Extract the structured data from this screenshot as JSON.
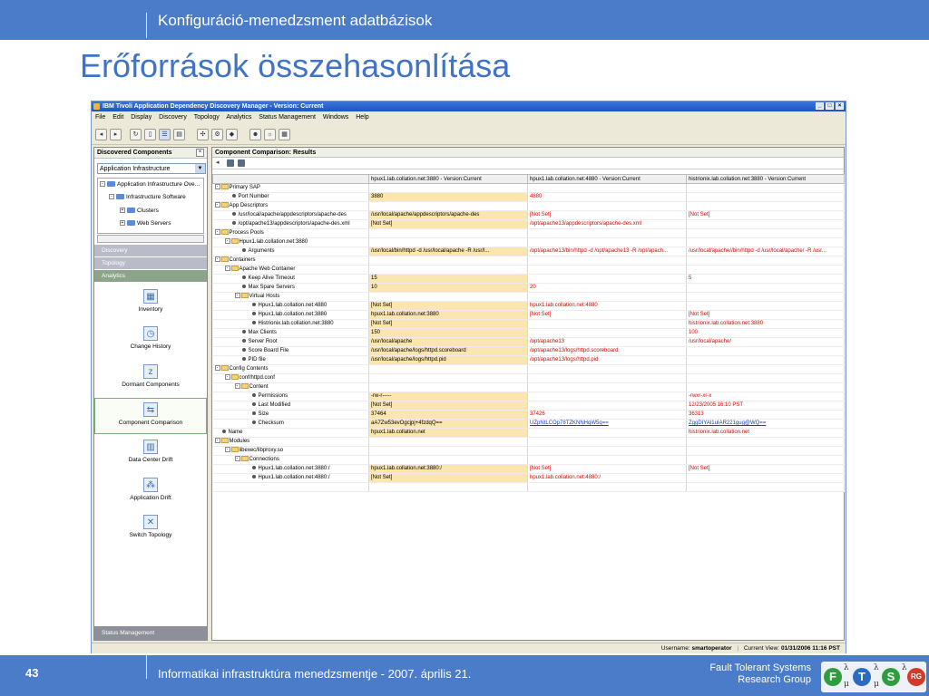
{
  "slide": {
    "header": "Konfiguráció-menedzsment adatbázisok",
    "title": "Erőforrások összehasonlítása",
    "page_number": "43",
    "footer": "Informatikai infrastruktúra menedzsmentje - 2007. április 21.",
    "org_line1": "Fault Tolerant Systems",
    "org_line2": "Research Group",
    "logo": {
      "f": "F",
      "t": "T",
      "s": "S",
      "rg": "RG",
      "lambda": "λ",
      "mu": "μ"
    }
  },
  "colors": {
    "bar": "#4a7cc9",
    "title": "#3f73c6",
    "highlight": "#fce6b0",
    "red": "#e00000"
  },
  "app": {
    "title": "IBM Tivoli Application Dependency Discovery Manager - Version: Current",
    "menu": [
      "File",
      "Edit",
      "Display",
      "Discovery",
      "Topology",
      "Analytics",
      "Status Management",
      "Windows",
      "Help"
    ],
    "left": {
      "header": "Discovered Components",
      "select": "Application Infrastructure",
      "tree": [
        "Application Infrastructure Ove...",
        "Infrastructure Software",
        "Clusters",
        "Web Servers"
      ],
      "nav": [
        "Discovery",
        "Topology",
        "Analytics"
      ],
      "items": [
        "Inventory",
        "Change History",
        "Dormant Components",
        "Component Comparison",
        "Data Center Drift",
        "Application Drift",
        "Switch Topology"
      ],
      "status_mgmt": "Status Management"
    },
    "right": {
      "header": "Component Comparison: Results",
      "columns": [
        "hpux1.lab.collation.net:3880 - Version:Current",
        "hpux1.lab.collation.net:4880 - Version:Current",
        "histrionix.lab.collation.net:3880 - Version:Current"
      ],
      "rows": [
        {
          "l": "Primary SAP",
          "d": 0,
          "k": "f",
          "v": [
            "",
            "",
            ""
          ]
        },
        {
          "l": "Port Number",
          "d": 1,
          "k": "b",
          "v": [
            "3880",
            "4880",
            ""
          ],
          "c": [
            "v1",
            "red",
            ""
          ]
        },
        {
          "l": "App Descriptors",
          "d": 0,
          "k": "f",
          "v": [
            "",
            "",
            ""
          ]
        },
        {
          "l": "/usr/local/apache/appdescriptors/apache-des",
          "d": 1,
          "k": "b",
          "v": [
            "/usr/local/apache/appdescriptors/apache-des",
            "[Not Set]",
            "[Not Set]"
          ],
          "c": [
            "v1",
            "red",
            "red"
          ]
        },
        {
          "l": "/opt/apache13/appdescriptors/apache-des.xml",
          "d": 1,
          "k": "b",
          "v": [
            "[Not Set]",
            "/opt/apache13/appdescriptors/apache-des.xml",
            ""
          ],
          "c": [
            "v1",
            "red",
            ""
          ]
        },
        {
          "l": "Process Pools",
          "d": 0,
          "k": "f",
          "v": [
            "",
            "",
            ""
          ]
        },
        {
          "l": "Hpux1.lab.collation.net:3880",
          "d": 1,
          "k": "f",
          "v": [
            "",
            "",
            ""
          ]
        },
        {
          "l": "Arguments",
          "d": 2,
          "k": "b",
          "v": [
            "/usr/local/bin/httpd -d /usr/local/apache -R /usr/l...",
            "/opt/apache13/bin/httpd -d /opt/apache13 -R /opt/apach...",
            "/usr/local/apache//bin/httpd -d /usr/local/apache/ -R /usr..."
          ],
          "c": [
            "v1",
            "red",
            "red"
          ]
        },
        {
          "l": "Containers",
          "d": 0,
          "k": "f",
          "v": [
            "",
            "",
            ""
          ]
        },
        {
          "l": "Apache Web Container",
          "d": 1,
          "k": "f",
          "v": [
            "",
            "",
            ""
          ]
        },
        {
          "l": "Keep Alive Timeout",
          "d": 2,
          "k": "b",
          "v": [
            "15",
            "",
            "5"
          ],
          "c": [
            "v1",
            "",
            "red"
          ]
        },
        {
          "l": "Max Spare Servers",
          "d": 2,
          "k": "b",
          "v": [
            "10",
            "20",
            ""
          ],
          "c": [
            "v1",
            "red",
            ""
          ]
        },
        {
          "l": "Virtual Hosts",
          "d": 2,
          "k": "f",
          "v": [
            "",
            "",
            ""
          ]
        },
        {
          "l": "Hpux1.lab.collation.net:4880",
          "d": 3,
          "k": "b",
          "v": [
            "[Not Set]",
            "hpux1.lab.collation.net:4880",
            ""
          ],
          "c": [
            "v1",
            "red",
            ""
          ]
        },
        {
          "l": "Hpux1.lab.collation.net:3880",
          "d": 3,
          "k": "b",
          "v": [
            "hpux1.lab.collation.net:3880",
            "[Not Set]",
            "[Not Set]"
          ],
          "c": [
            "v1",
            "red",
            "red"
          ]
        },
        {
          "l": "Histrionix.lab.collation.net:3880",
          "d": 3,
          "k": "b",
          "v": [
            "[Not Set]",
            "",
            "histrionix.lab.collation.net:3880"
          ],
          "c": [
            "v1",
            "",
            "red"
          ]
        },
        {
          "l": "Max Clients",
          "d": 2,
          "k": "b",
          "v": [
            "150",
            "",
            "100"
          ],
          "c": [
            "v1",
            "",
            "red"
          ]
        },
        {
          "l": "Server Root",
          "d": 2,
          "k": "b",
          "v": [
            "/usr/local/apache",
            "/opt/apache13",
            "/usr/local/apache/"
          ],
          "c": [
            "v1",
            "red",
            "red"
          ]
        },
        {
          "l": "Score Board File",
          "d": 2,
          "k": "b",
          "v": [
            "/usr/local/apache/logs/httpd.scoreboard",
            "/opt/apache13/logs/httpd.scoreboard",
            ""
          ],
          "c": [
            "v1",
            "red",
            ""
          ]
        },
        {
          "l": "PID file",
          "d": 2,
          "k": "b",
          "v": [
            "/usr/local/apache/logs/httpd.pid",
            "/opt/apache13/logs/httpd.pid",
            ""
          ],
          "c": [
            "v1",
            "red",
            ""
          ]
        },
        {
          "l": "Config Contents",
          "d": 0,
          "k": "f",
          "v": [
            "",
            "",
            ""
          ]
        },
        {
          "l": "conf/httpd.conf",
          "d": 1,
          "k": "f",
          "v": [
            "",
            "",
            ""
          ]
        },
        {
          "l": "Content",
          "d": 2,
          "k": "f",
          "v": [
            "",
            "",
            ""
          ]
        },
        {
          "l": "Permissions",
          "d": 3,
          "k": "b",
          "v": [
            "-rw-r-----",
            "",
            "-rwxr-xr-x"
          ],
          "c": [
            "v1",
            "",
            "red"
          ]
        },
        {
          "l": "Last Modified",
          "d": 3,
          "k": "b",
          "v": [
            "[Not Set]",
            "",
            "12/23/2005 16:10 PST"
          ],
          "c": [
            "v1",
            "",
            "red"
          ]
        },
        {
          "l": "Size",
          "d": 3,
          "k": "b",
          "v": [
            "37464",
            "37426",
            "36313"
          ],
          "c": [
            "v1",
            "red",
            "red"
          ]
        },
        {
          "l": "Checksum",
          "d": 3,
          "k": "b",
          "v": [
            "aA7Zw53evOgcjpj+4fzdqQ==",
            "UZpNtLCOp78TZKNNHqW5q==",
            "ZggDIYAl1uIAR221gug@WQ=="
          ],
          "c": [
            "v1",
            "blue",
            "blue"
          ]
        },
        {
          "l": "Name",
          "d": 0,
          "k": "b",
          "v": [
            "hpux1.lab.collation.net",
            "",
            "histrionix.lab.collation.net"
          ],
          "c": [
            "v1",
            "",
            "red"
          ]
        },
        {
          "l": "Modules",
          "d": 0,
          "k": "f",
          "v": [
            "",
            "",
            ""
          ]
        },
        {
          "l": "libexec/libproxy.so",
          "d": 1,
          "k": "f",
          "v": [
            "",
            "",
            ""
          ]
        },
        {
          "l": "Connections",
          "d": 2,
          "k": "f",
          "v": [
            "",
            "",
            ""
          ]
        },
        {
          "l": "Hpux1.lab.collation.net:3880:/",
          "d": 3,
          "k": "b",
          "v": [
            "hpux1.lab.collation.net:3880:/",
            "[Not Set]",
            "[Not Set]"
          ],
          "c": [
            "v1",
            "red",
            "red"
          ]
        },
        {
          "l": "Hpux1.lab.collation.net:4880:/",
          "d": 3,
          "k": "b",
          "v": [
            "[Not Set]",
            "hpux1.lab.collation.net:4880:/",
            ""
          ],
          "c": [
            "v1",
            "red",
            ""
          ]
        }
      ]
    },
    "status": {
      "user_label": "Username:",
      "user": "smartoperator",
      "view_label": "Current View:",
      "view": "01/31/2006 11:16 PST"
    }
  }
}
